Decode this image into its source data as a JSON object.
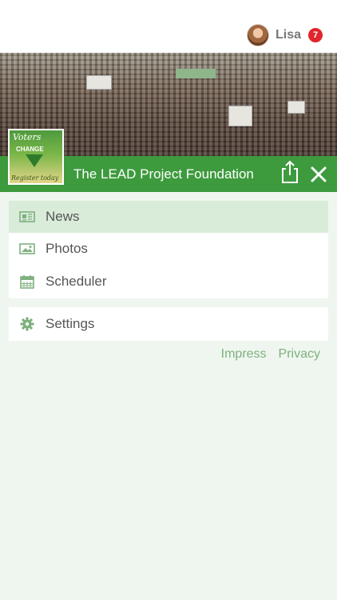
{
  "header": {
    "user_name": "Lisa",
    "notification_count": "7"
  },
  "organization": {
    "title": "The LEAD Project Foundation",
    "logo_text_top": "Voters",
    "logo_text_mid": "CHANGE",
    "logo_text_bottom": "Register today"
  },
  "menu": {
    "items": [
      {
        "label": "News",
        "icon": "newspaper-icon",
        "active": true
      },
      {
        "label": "Photos",
        "icon": "image-icon",
        "active": false
      },
      {
        "label": "Scheduler",
        "icon": "calendar-icon",
        "active": false
      }
    ],
    "settings": {
      "label": "Settings",
      "icon": "gear-icon"
    }
  },
  "footer": {
    "impress": "Impress",
    "privacy": "Privacy"
  },
  "colors": {
    "brand_green": "#3d9a3d",
    "active_item_bg": "#d9ebd9",
    "page_bg": "#eff6ef",
    "badge_red": "#e0252b",
    "link_green": "#7fb07f"
  }
}
